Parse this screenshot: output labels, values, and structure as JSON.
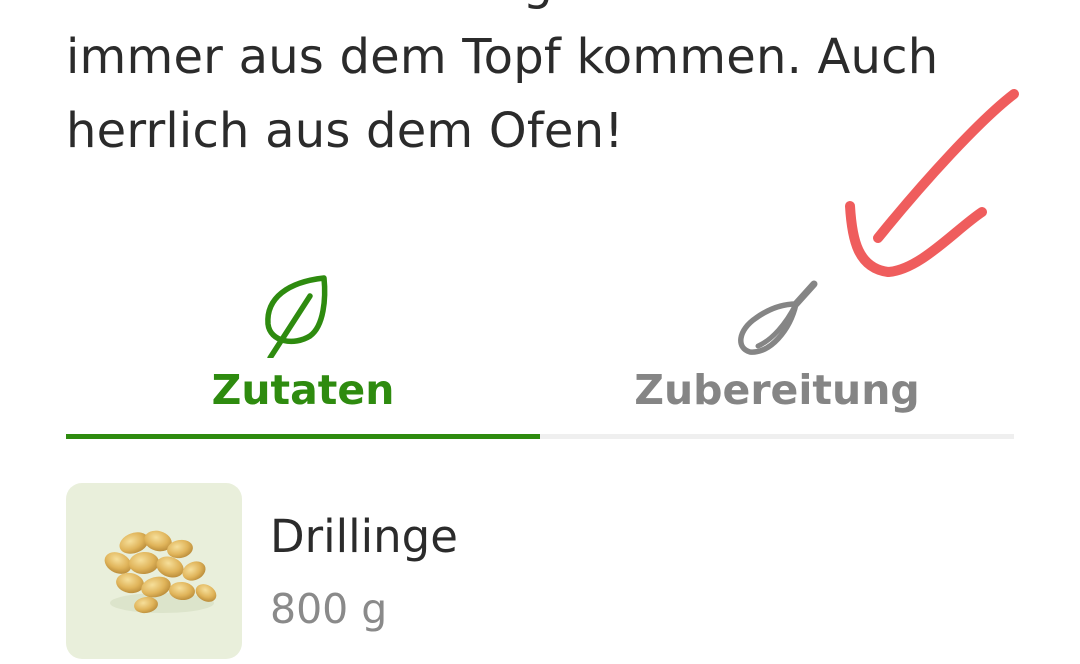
{
  "recipe": {
    "description_lines": [
      "Das leckere Saisongemüse muss nicht",
      "immer aus dem Topf kommen. Auch",
      "herrlich aus dem Ofen!"
    ]
  },
  "tabs": [
    {
      "label": "Zutaten",
      "icon": "leaf-icon",
      "active": true
    },
    {
      "label": "Zubereitung",
      "icon": "whisk-icon",
      "active": false
    }
  ],
  "ingredients": [
    {
      "name": "Drillinge",
      "amount": "800 g",
      "image": "potatoes"
    }
  ],
  "colors": {
    "accent": "#2e8b0f",
    "inactive": "#858585",
    "text": "#2b2b2b",
    "muted": "#8a8a8a",
    "annotation": "#ef5d5d",
    "thumb_bg": "#e9efdb"
  }
}
